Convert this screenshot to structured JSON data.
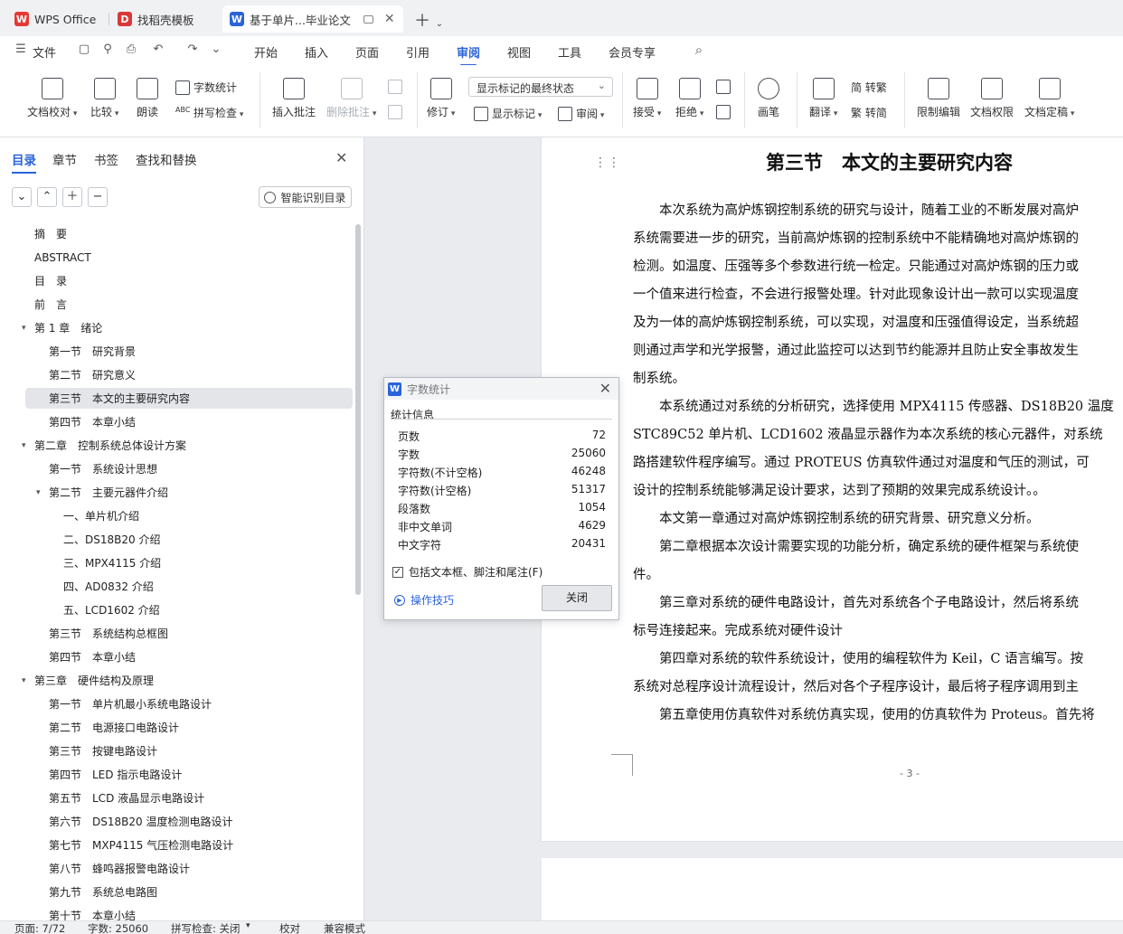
{
  "tabs": [
    {
      "label": "WPS Office",
      "logo": "W",
      "logo_color": "#e53935"
    },
    {
      "label": "找稻壳模板",
      "logo": "D",
      "logo_color": "#d93838"
    },
    {
      "label": "基于单片...毕业论文",
      "logo": "W",
      "logo_color": "#2b63d9"
    }
  ],
  "menu": {
    "file": "文件",
    "items": [
      "开始",
      "插入",
      "页面",
      "引用",
      "审阅",
      "视图",
      "工具",
      "会员专享"
    ],
    "active": "审阅"
  },
  "ribbon": {
    "doc_check": "文档校对",
    "compare": "比较",
    "read_aloud": "朗读",
    "word_count": "字数统计",
    "spell_check": "拼写检查",
    "insert_comment": "插入批注",
    "delete_comment": "删除批注",
    "revise": "修订",
    "markup_select": "显示标记的最终状态",
    "show_markup": "显示标记",
    "review": "审阅",
    "accept": "接受",
    "reject": "拒绝",
    "pen": "画笔",
    "translate": "翻译",
    "to_traditional": "简 转繁",
    "to_simplified": "繁 转简",
    "restrict_edit": "限制编辑",
    "doc_permission": "文档权限",
    "doc_finalize": "文档定稿"
  },
  "nav": {
    "tabs": [
      "目录",
      "章节",
      "书签",
      "查找和替换"
    ],
    "active_tab": "目录",
    "smart_btn": "智能识别目录",
    "toc": [
      {
        "text": "摘　要",
        "level": 0,
        "caret": ""
      },
      {
        "text": "ABSTRACT",
        "level": 0,
        "caret": ""
      },
      {
        "text": "目　录",
        "level": 0,
        "caret": ""
      },
      {
        "text": "前　言",
        "level": 0,
        "caret": ""
      },
      {
        "text": "第 1 章　绪论",
        "level": 0,
        "caret": "▾"
      },
      {
        "text": "第一节　研究背景",
        "level": 1,
        "caret": ""
      },
      {
        "text": "第二节　研究意义",
        "level": 1,
        "caret": ""
      },
      {
        "text": "第三节　本文的主要研究内容",
        "level": 1,
        "caret": "",
        "selected": true
      },
      {
        "text": "第四节　本章小结",
        "level": 1,
        "caret": ""
      },
      {
        "text": "第二章　控制系统总体设计方案",
        "level": 0,
        "caret": "▾"
      },
      {
        "text": "第一节　系统设计思想",
        "level": 1,
        "caret": ""
      },
      {
        "text": "第二节　主要元器件介绍",
        "level": 1,
        "caret": "▾"
      },
      {
        "text": "一、单片机介绍",
        "level": 2,
        "caret": ""
      },
      {
        "text": "二、DS18B20 介绍",
        "level": 2,
        "caret": ""
      },
      {
        "text": "三、MPX4115 介绍",
        "level": 2,
        "caret": ""
      },
      {
        "text": "四、AD0832 介绍",
        "level": 2,
        "caret": ""
      },
      {
        "text": "五、LCD1602 介绍",
        "level": 2,
        "caret": ""
      },
      {
        "text": "第三节　系统结构总框图",
        "level": 1,
        "caret": ""
      },
      {
        "text": "第四节　本章小结",
        "level": 1,
        "caret": ""
      },
      {
        "text": "第三章　硬件结构及原理",
        "level": 0,
        "caret": "▾"
      },
      {
        "text": "第一节　单片机最小系统电路设计",
        "level": 1,
        "caret": ""
      },
      {
        "text": "第二节　电源接口电路设计",
        "level": 1,
        "caret": ""
      },
      {
        "text": "第三节　按键电路设计",
        "level": 1,
        "caret": ""
      },
      {
        "text": "第四节　LED 指示电路设计",
        "level": 1,
        "caret": ""
      },
      {
        "text": "第五节　LCD 液晶显示电路设计",
        "level": 1,
        "caret": ""
      },
      {
        "text": "第六节　DS18B20 温度检测电路设计",
        "level": 1,
        "caret": ""
      },
      {
        "text": "第七节　MXP4115 气压检测电路设计",
        "level": 1,
        "caret": ""
      },
      {
        "text": "第八节　蜂鸣器报警电路设计",
        "level": 1,
        "caret": ""
      },
      {
        "text": "第九节　系统总电路图",
        "level": 1,
        "caret": ""
      },
      {
        "text": "第十节　本章小结",
        "level": 1,
        "caret": ""
      }
    ]
  },
  "document": {
    "heading": "第三节　本文的主要研究内容",
    "lines": [
      "　　本次系统为高炉炼钢控制系统的研究与设计，随着工业的不断发展对高炉",
      "系统需要进一步的研究，当前高炉炼钢的控制系统中不能精确地对高炉炼钢的",
      "检测。如温度、压强等多个参数进行统一检定。只能通过对高炉炼钢的压力或",
      "一个值来进行检查，不会进行报警处理。针对此现象设计出一款可以实现温度",
      "及为一体的高炉炼钢控制系统，可以实现，对温度和压强值得设定，当系统超",
      "则通过声学和光学报警，通过此监控可以达到节约能源并且防止安全事故发生",
      "制系统。",
      "　　本系统通过对系统的分析研究，选择使用 MPX4115 传感器、DS18B20 温度",
      "STC89C52 单片机、LCD1602 液晶显示器作为本次系统的核心元器件，对系统",
      "路搭建软件程序编写。通过 PROTEUS 仿真软件通过对温度和气压的测试，可",
      "设计的控制系统能够满足设计要求，达到了预期的效果完成系统设计。。",
      "　　本文第一章通过对高炉炼钢控制系统的研究背景、研究意义分析。",
      "　　第二章根据本次设计需要实现的功能分析，确定系统的硬件框架与系统使",
      "件。",
      "　　第三章对系统的硬件电路设计，首先对系统各个子电路设计，然后将系统",
      "标号连接起来。完成系统对硬件设计",
      "　　第四章对系统的软件系统设计，使用的编程软件为 Keil，C 语言编写。按",
      "系统对总程序设计流程设计，然后对各个子程序设计，最后将子程序调用到主",
      "　　第五章使用仿真软件对系统仿真实现，使用的仿真软件为 Proteus。首先将"
    ],
    "page_number": "- 3 -"
  },
  "dialog": {
    "title": "字数统计",
    "group": "统计信息",
    "stats": [
      {
        "label": "页数",
        "value": "72"
      },
      {
        "label": "字数",
        "value": "25060"
      },
      {
        "label": "字符数(不计空格)",
        "value": "46248"
      },
      {
        "label": "字符数(计空格)",
        "value": "51317"
      },
      {
        "label": "段落数",
        "value": "1054"
      },
      {
        "label": "非中文单词",
        "value": "4629"
      },
      {
        "label": "中文字符",
        "value": "20431"
      }
    ],
    "checkbox": "包括文本框、脚注和尾注(F)",
    "checkbox_checked": "✓",
    "tips": "操作技巧",
    "close": "关闭"
  },
  "status": {
    "page": "页面: 7/72",
    "words": "字数: 25060",
    "spell": "拼写检查: 关闭",
    "proof": "校对",
    "compat": "兼容模式"
  },
  "colors": {
    "accent": "#2b63d9",
    "wps_red": "#e53935"
  }
}
